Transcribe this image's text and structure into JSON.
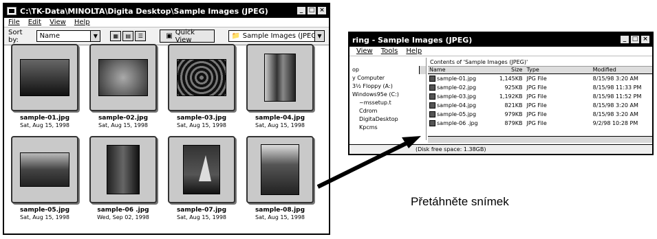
{
  "viewer": {
    "title": "C:\\TK-Data\\MINOLTA\\Digita Desktop\\Sample Images (JPEG)",
    "menu": [
      "File",
      "Edit",
      "View",
      "Help"
    ],
    "sort_label": "Sort by:",
    "sort_value": "Name",
    "quick_view_label": "Quick View",
    "folder_value": "Sample Images (JPEG)",
    "thumbnails": [
      {
        "name": "sample-01.jpg",
        "date": "Sat, Aug 15, 1998"
      },
      {
        "name": "sample-02.jpg",
        "date": "Sat, Aug 15, 1998"
      },
      {
        "name": "sample-03.jpg",
        "date": "Sat, Aug 15, 1998"
      },
      {
        "name": "sample-04.jpg",
        "date": "Sat, Aug 15, 1998"
      },
      {
        "name": "sample-05.jpg",
        "date": "Sat, Aug 15, 1998"
      },
      {
        "name": "sample-06 .jpg",
        "date": "Wed, Sep 02, 1998"
      },
      {
        "name": "sample-07.jpg",
        "date": "Sat, Aug 15, 1998"
      },
      {
        "name": "sample-08.jpg",
        "date": "Sat, Aug 15, 1998"
      }
    ]
  },
  "explorer": {
    "title": "ring - Sample Images (JPEG)",
    "menu": [
      "View",
      "Tools",
      "Help"
    ],
    "contents_caption": "Contents of 'Sample Images (JPEG)'",
    "tree": [
      "op",
      "y Computer",
      "3½ Floppy (A:)",
      "Windows95e (C:)",
      "~mssetup.t",
      "Cdrom",
      "DigitaDesktop",
      "Kpcms"
    ],
    "columns": [
      "Name",
      "Size",
      "Type",
      "Modified"
    ],
    "rows": [
      {
        "name": "sample-01.jpg",
        "size": "1,145KB",
        "type": "JPG File",
        "modified": "8/15/98 3:20 AM"
      },
      {
        "name": "sample-02.jpg",
        "size": "925KB",
        "type": "JPG File",
        "modified": "8/15/98 11:33 PM"
      },
      {
        "name": "sample-03.jpg",
        "size": "1,192KB",
        "type": "JPG File",
        "modified": "8/15/98 11:52 PM"
      },
      {
        "name": "sample-04.jpg",
        "size": "821KB",
        "type": "JPG File",
        "modified": "8/15/98 3:20 AM"
      },
      {
        "name": "sample-05.jpg",
        "size": "979KB",
        "type": "JPG File",
        "modified": "8/15/98 3:20 AM"
      },
      {
        "name": "sample-06 .jpg",
        "size": "879KB",
        "type": "JPG File",
        "modified": "9/2/98 10:28 PM"
      }
    ],
    "status": "(Disk free space: 1.38GB)"
  },
  "caption": "Přetáhněte snímek"
}
